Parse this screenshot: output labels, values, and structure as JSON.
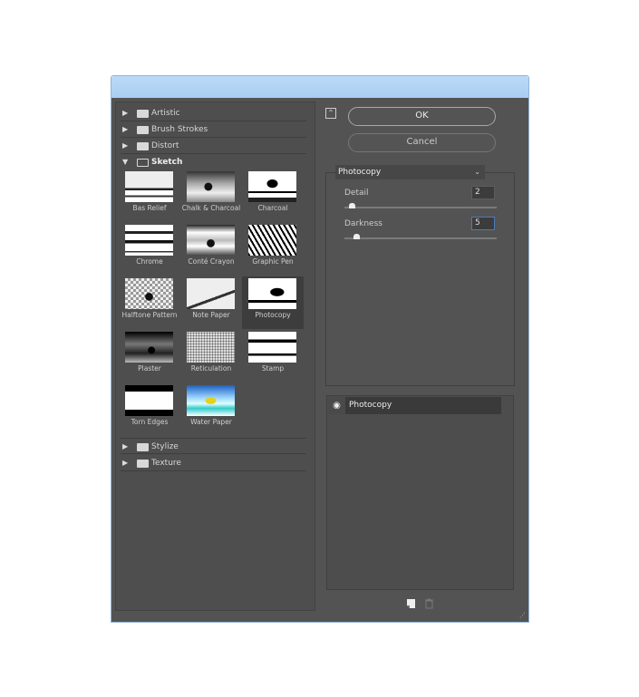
{
  "categories_top": [
    {
      "label": "Artistic",
      "expanded": false
    },
    {
      "label": "Brush Strokes",
      "expanded": false
    },
    {
      "label": "Distort",
      "expanded": false
    },
    {
      "label": "Sketch",
      "expanded": true
    }
  ],
  "filters": [
    {
      "label": "Bas Relief"
    },
    {
      "label": "Chalk & Charcoal"
    },
    {
      "label": "Charcoal"
    },
    {
      "label": "Chrome"
    },
    {
      "label": "Conté Crayon"
    },
    {
      "label": "Graphic Pen"
    },
    {
      "label": "Halftone Pattern"
    },
    {
      "label": "Note Paper"
    },
    {
      "label": "Photocopy",
      "selected": true
    },
    {
      "label": "Plaster"
    },
    {
      "label": "Reticulation"
    },
    {
      "label": "Stamp"
    },
    {
      "label": "Torn Edges"
    },
    {
      "label": "Water Paper"
    }
  ],
  "categories_bottom": [
    {
      "label": "Stylize"
    },
    {
      "label": "Texture"
    }
  ],
  "buttons": {
    "ok": "OK",
    "cancel": "Cancel"
  },
  "settings": {
    "filter_select": "Photocopy",
    "params": [
      {
        "label": "Detail",
        "value": "2",
        "fraction": 0.05
      },
      {
        "label": "Darkness",
        "value": "5",
        "fraction": 0.08
      }
    ]
  },
  "effects_layers": [
    {
      "label": "Photocopy",
      "visible": true
    }
  ],
  "icons": {
    "new_layer": "new-effect-layer-icon",
    "delete": "trash-icon",
    "collapse": "collapse-icon"
  }
}
